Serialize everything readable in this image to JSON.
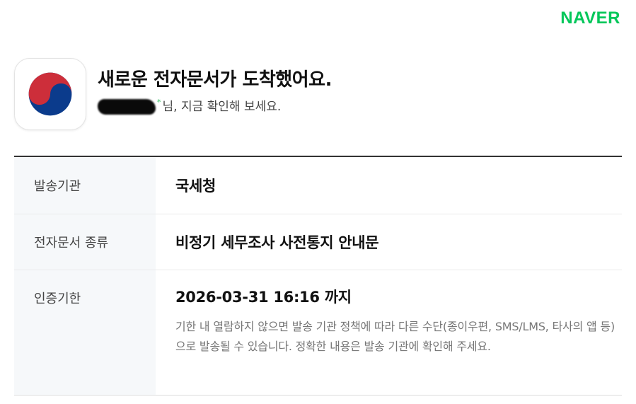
{
  "brand": {
    "name": "NAVER",
    "color": "#03c75a"
  },
  "notification": {
    "app_icon": "korea-government-taegeuk-emblem",
    "headline": "새로운 전자문서가 도착했어요.",
    "recipient_suffix": "님, 지금 확인해 보세요.",
    "recipient_marker": "*"
  },
  "details": {
    "rows": [
      {
        "label": "발송기관",
        "value": "국세청"
      },
      {
        "label": "전자문서 종류",
        "value": "비정기 세무조사 사전통지 안내문"
      },
      {
        "label": "인증기한",
        "value": "2026-03-31 16:16 까지",
        "note": "기한 내 열람하지 않으면 발송 기관 정책에 따라 다른 수단(종이우편, SMS/LMS, 타사의 앱 등) 으로 발송될 수 있습니다. 정확한 내용은 발송 기관에 확인해 주세요."
      }
    ]
  }
}
